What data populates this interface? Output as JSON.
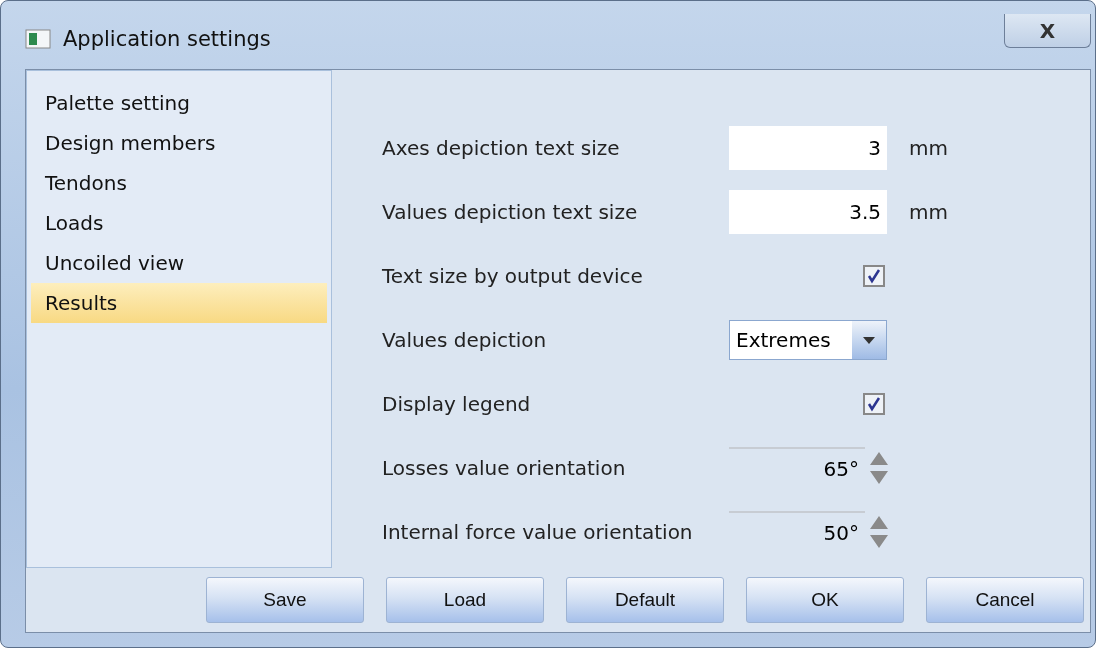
{
  "window": {
    "title": "Application settings",
    "close_label": "X"
  },
  "sidebar": {
    "items": [
      {
        "label": "Palette setting",
        "selected": false
      },
      {
        "label": "Design members",
        "selected": false
      },
      {
        "label": "Tendons",
        "selected": false
      },
      {
        "label": "Loads",
        "selected": false
      },
      {
        "label": "Uncoiled view",
        "selected": false
      },
      {
        "label": "Results",
        "selected": true
      }
    ]
  },
  "settings": [
    {
      "kind": "number",
      "label": "Axes depiction text size",
      "value": "3",
      "unit": "mm"
    },
    {
      "kind": "number",
      "label": "Values depiction text size",
      "value": "3.5",
      "unit": "mm"
    },
    {
      "kind": "checkbox",
      "label": "Text size by output device",
      "checked": true
    },
    {
      "kind": "dropdown",
      "label": "Values depiction",
      "value": "Extremes"
    },
    {
      "kind": "checkbox",
      "label": "Display legend",
      "checked": true
    },
    {
      "kind": "spinner",
      "label": "Losses value orientation",
      "value": "65°"
    },
    {
      "kind": "spinner",
      "label": "Internal force value orientation",
      "value": "50°"
    }
  ],
  "buttons": [
    "Save",
    "Load",
    "Default",
    "OK",
    "Cancel"
  ]
}
